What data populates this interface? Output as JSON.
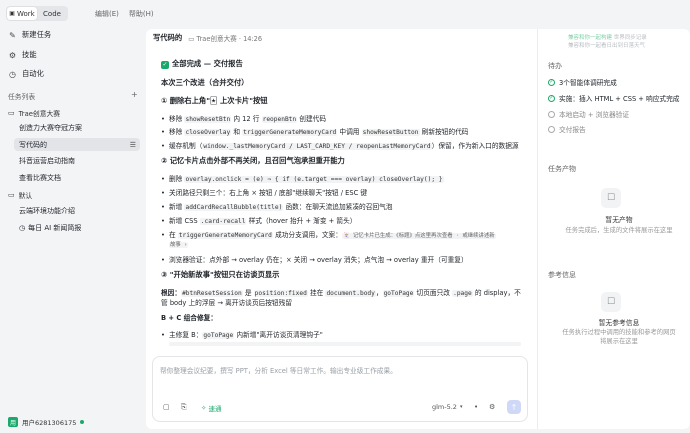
{
  "topbar": {
    "tabs": [
      "Work",
      "Code"
    ],
    "menu": [
      "编辑(E)",
      "帮助(H)"
    ]
  },
  "sidebar": {
    "nav": [
      {
        "icon": "edit-icon",
        "label": "新建任务"
      },
      {
        "icon": "skill-icon",
        "label": "技能"
      },
      {
        "icon": "automation-icon",
        "label": "自动化"
      }
    ],
    "task_list_label": "任务列表",
    "group1": {
      "label": "Trae创意大赛",
      "items": [
        "创造力大赛夺冠方案",
        "写代码的",
        "抖音运营启动指南",
        "查看比赛文档"
      ]
    },
    "group2": {
      "label": "默认",
      "items": [
        "云端环境功能介绍",
        "每日 AI 新闻简报"
      ]
    },
    "user": {
      "avatar": "用",
      "name": "用户6281306175"
    }
  },
  "header": {
    "title": "写代码的",
    "project": "Trae创意大赛",
    "time": "14:26"
  },
  "watermark": {
    "line1_a": "兼容和你一起构建",
    "line1_b": "世界同步记录",
    "line2": "兼容和你一起看日出到日落天气"
  },
  "doc": {
    "done_title": "全部完成 — 交付报告",
    "summary": "本次三个改进（合并交付）",
    "s1": "① 删除右上角\"🃏 上次卡片\"按钮",
    "s1_b1_a": "移除",
    "s1_b1_code": "showResetBtn",
    "s1_b1_b": "内 12 行",
    "s1_b1_code2": "reopenBtn",
    "s1_b1_c": "创建代码",
    "s1_b2_a": "移除",
    "s1_b2_code": "closeOverlay",
    "s1_b2_b": "和",
    "s1_b2_code2": "triggerGenerateMemoryCard",
    "s1_b2_c": "中调用",
    "s1_b2_code3": "showResetButton",
    "s1_b2_d": "刷新按钮的代码",
    "s1_b3_a": "缓存机制（",
    "s1_b3_code": "window._lastMemoryCard / LAST_CARD_KEY / reopenLastMemoryCard",
    "s1_b3_b": "）保留，作为新入口的数据源",
    "s2": "② 记忆卡片点击外部不再关闭，且召回气泡承担重开能力",
    "s2_b1_a": "删除",
    "s2_b1_code": "overlay.onclick = (e) ⇒ { if (e.target === overlay) closeOverlay(); }",
    "s2_b2": "关闭路径只剩三个：右上角 × 按钮 / 底部\"继续聊天\"按钮 / ESC 键",
    "s2_b3_a": "新增",
    "s2_b3_code": "addCardRecallBubble(title)",
    "s2_b3_b": "函数：在聊天流追加紧凑的召回气泡",
    "s2_b4_a": "新增 CSS",
    "s2_b4_code": ".card-recall",
    "s2_b4_b": "样式（hover 抬升 + 渐变 + 箭头）",
    "s2_b5_a": "在",
    "s2_b5_code": "triggerGenerateMemoryCard",
    "s2_b5_b": "成功分支调用，文案：",
    "s2_b5_code2": "🃏 记忆卡片已生成：《标题》点这里再次查看 · 或继续讲述新",
    "s2_b5_code3": "故事 ›",
    "s2_b6": "浏览器验证：点外部 → overlay 仍在；× 关闭 → overlay 消失；点气泡 → overlay 重开（可重复）",
    "s3": "③ \"开始新故事\"按钮只在访谈页显示",
    "s3_l1_a": "根因：",
    "s3_l1_code": "#btnResetSession",
    "s3_l1_b": "是",
    "s3_l1_code2": "position:fixed",
    "s3_l1_c": "挂在",
    "s3_l1_code3": "document.body",
    "s3_l1_d": "，",
    "s3_l1_code4": "goToPage",
    "s3_l1_e": "切页面只改",
    "s3_l1_code5": ".page",
    "s3_l1_f": "的 display，不",
    "s3_l2": "管 body 上的浮层 → 离开访谈页后按钮残留",
    "s3_fix": "B + C 组合修复：",
    "s3_b1_a": "主修复 B：",
    "s3_b1_code": "goToPage",
    "s3_b1_b": "内新增\"离开访谈页清理钩子\""
  },
  "composer": {
    "placeholder": "帮你整理会议纪要，撰写 PPT，分析 Excel 等日常工作。输出专业级工作成果。",
    "mode": "速通",
    "model": "glm-5.2"
  },
  "right": {
    "todo_label": "待办",
    "todos": [
      {
        "label": "3个智能体调研完成",
        "state": "done"
      },
      {
        "label": "实施：插入 HTML + CSS + 响应式完成",
        "state": "done"
      },
      {
        "label": "本地启动 + 浏览器验证",
        "state": "pending"
      },
      {
        "label": "交付报告",
        "state": "pending"
      }
    ],
    "products_label": "任务产物",
    "products_empty": "暂无产物",
    "products_hint": "任务完成后，生成的文件将展示在这里",
    "refs_label": "参考信息",
    "refs_empty": "暂无参考信息",
    "refs_hint1": "任务执行过程中调用的技能和参考的网页",
    "refs_hint2": "将展示在这里"
  }
}
